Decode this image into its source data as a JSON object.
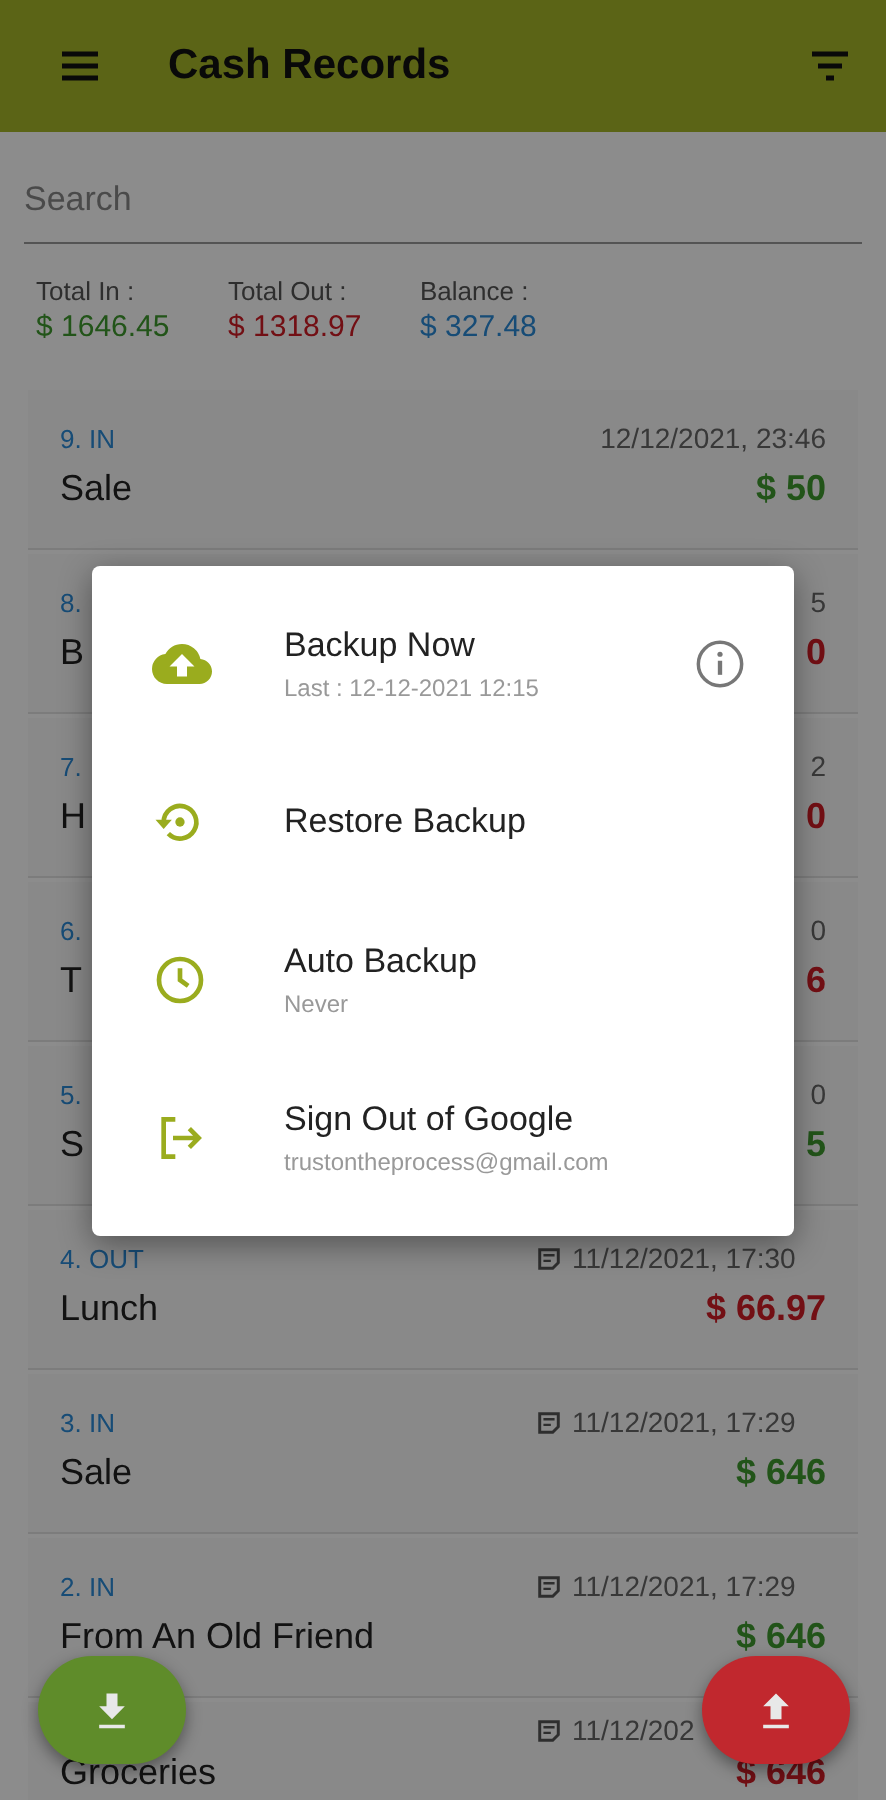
{
  "app_bar": {
    "title": "Cash Records"
  },
  "search": {
    "placeholder": "Search"
  },
  "totals": [
    {
      "label": "Total In :",
      "value": "$ 1646.45",
      "kind": "in"
    },
    {
      "label": "Total Out :",
      "value": "$ 1318.97",
      "kind": "out"
    },
    {
      "label": "Balance :",
      "value": "$ 327.48",
      "kind": "balance"
    }
  ],
  "records": [
    {
      "label": "9. IN",
      "date": "12/12/2021, 23:46",
      "name": "Sale",
      "amount": "$ 50",
      "kind": "in",
      "note": false
    },
    {
      "label": "8.",
      "date": "5",
      "name": "B",
      "amount": "0",
      "kind": "out",
      "note": false
    },
    {
      "label": "7.",
      "date": "2",
      "name": "H",
      "amount": "0",
      "kind": "out",
      "note": false
    },
    {
      "label": "6.",
      "date": "0",
      "name": "T",
      "amount": "6",
      "kind": "out",
      "note": false
    },
    {
      "label": "5.",
      "date": "0",
      "name": "S",
      "amount": "5",
      "kind": "in",
      "note": false
    },
    {
      "label": "4. OUT",
      "date": "11/12/2021, 17:30",
      "name": "Lunch",
      "amount": "$ 66.97",
      "kind": "out",
      "note": true
    },
    {
      "label": "3. IN",
      "date": "11/12/2021, 17:29",
      "name": "Sale",
      "amount": "$ 646",
      "kind": "in",
      "note": true
    },
    {
      "label": "2. IN",
      "date": "11/12/2021, 17:29",
      "name": "From An Old Friend",
      "amount": "$ 646",
      "kind": "in",
      "note": true
    },
    {
      "date": "11/12/202",
      "name": "Groceries",
      "amount": "$ 646",
      "kind": "out",
      "note": true
    }
  ],
  "dialog": {
    "items": [
      {
        "kind": "backup",
        "title": "Backup Now",
        "subtitle": "Last : 12-12-2021 12:15",
        "info": true
      },
      {
        "kind": "restore",
        "title": "Restore Backup",
        "info": false
      },
      {
        "kind": "auto",
        "title": "Auto Backup",
        "subtitle": "Never",
        "info": false
      },
      {
        "kind": "signout",
        "title": "Sign Out of Google",
        "subtitle": "trustontheprocess@gmail.com",
        "info": false
      }
    ]
  }
}
